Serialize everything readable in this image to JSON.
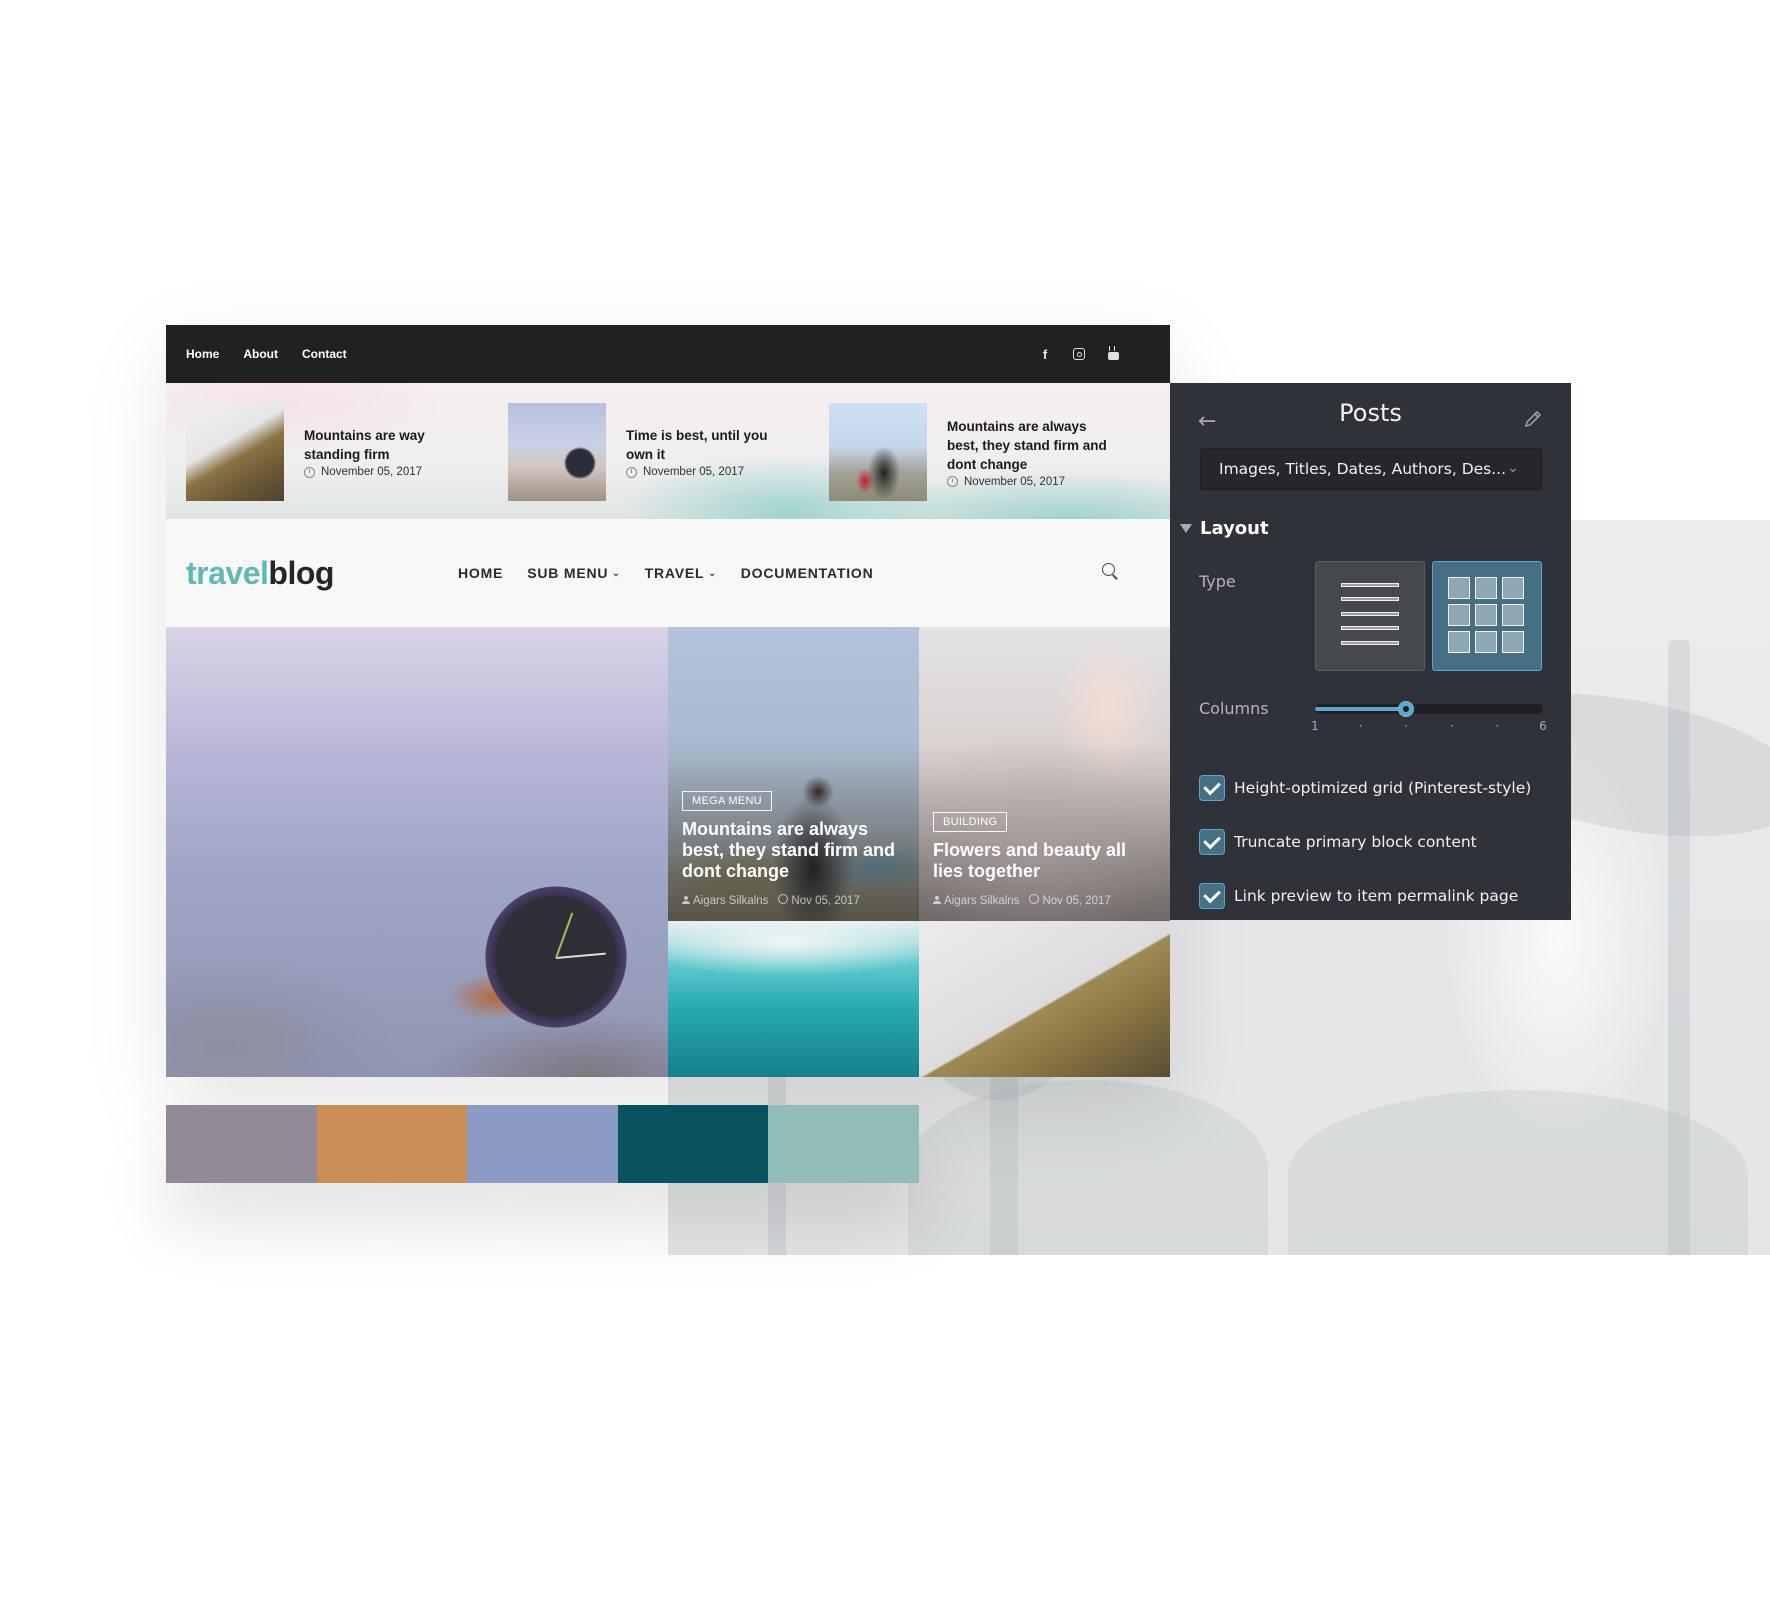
{
  "site": {
    "topbar": {
      "links": [
        "Home",
        "About",
        "Contact"
      ],
      "social_icons": [
        "facebook-icon",
        "instagram-icon",
        "youtube-icon"
      ]
    },
    "featured_posts": [
      {
        "title": "Mountains are way standing firm",
        "date": "November 05, 2017"
      },
      {
        "title": "Time is best, until you own it",
        "date": "November 05, 2017"
      },
      {
        "title": "Mountains are always best, they stand firm and dont change",
        "date": "November 05, 2017"
      }
    ],
    "logo": {
      "part1": "travel",
      "part2": "blog"
    },
    "nav": [
      {
        "label": "HOME",
        "has_dropdown": false
      },
      {
        "label": "SUB MENU",
        "has_dropdown": true
      },
      {
        "label": "TRAVEL",
        "has_dropdown": true
      },
      {
        "label": "DOCUMENTATION",
        "has_dropdown": false
      }
    ],
    "chevron_glyph": "⌄",
    "grid_cards": [
      {
        "tag": "MEGA MENU",
        "title": "Mountains are always best, they stand firm and dont change",
        "author": "Aigars Silkalns",
        "date": "Nov 05, 2017"
      },
      {
        "tag": "BUILDING",
        "title": "Flowers and beauty all lies together",
        "author": "Aigars Silkalns",
        "date": "Nov 05, 2017"
      }
    ]
  },
  "palette": {
    "swatches": [
      "#928a97",
      "#c98d58",
      "#8b9bc3",
      "#09535f",
      "#93bdb9"
    ]
  },
  "panel": {
    "back_glyph": "←",
    "title": "Posts",
    "dropdown": {
      "value": "Images, Titles, Dates, Authors, Des...",
      "chevron_glyph": "⌄"
    },
    "section": "Layout",
    "type_label": "Type",
    "type_options": [
      {
        "name": "list",
        "selected": false
      },
      {
        "name": "grid",
        "selected": true
      }
    ],
    "columns": {
      "label": "Columns",
      "min": 1,
      "max": 6,
      "value": 3,
      "min_label": "1",
      "max_label": "6"
    },
    "checkboxes": [
      {
        "label": "Height-optimized grid (Pinterest-style)",
        "checked": true
      },
      {
        "label": "Truncate primary block content",
        "checked": true
      },
      {
        "label": "Link preview to item permalink page",
        "checked": true
      }
    ],
    "accent_color": "#5fa7c9"
  }
}
